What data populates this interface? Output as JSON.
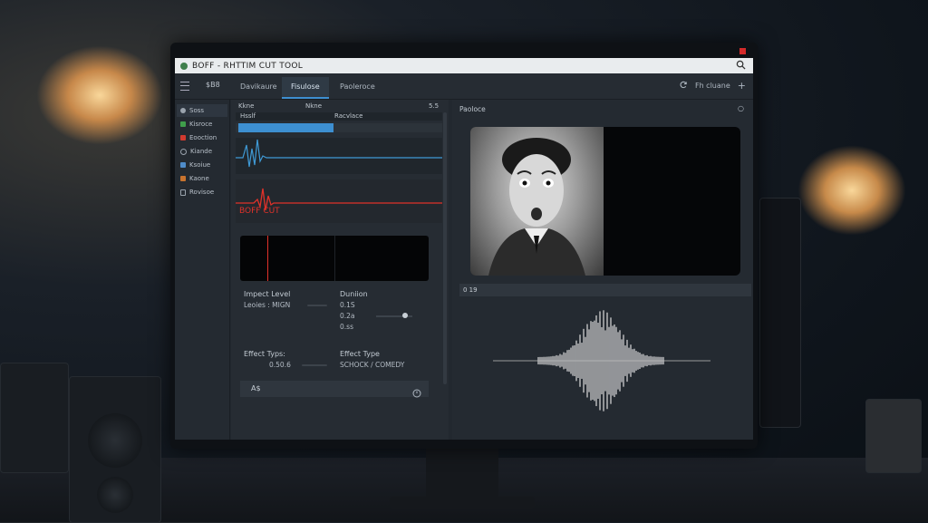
{
  "window": {
    "title": "BOFF - RHTTIM CUT TOOL"
  },
  "topbar": {
    "label": "$B8",
    "tabs": [
      {
        "label": "Davikaure",
        "active": false
      },
      {
        "label": "Fisulose",
        "active": true
      },
      {
        "label": "Paoleroce",
        "active": false
      }
    ],
    "right_label": "Fh cluane"
  },
  "sidebar": {
    "items": [
      {
        "label": "Soss",
        "icon": "gear-icon",
        "color": "#9aa3ad",
        "active": true
      },
      {
        "label": "Kisroce",
        "icon": "scissors-icon",
        "color": "#3f9e4b",
        "active": false
      },
      {
        "label": "Eooction",
        "icon": "record-icon",
        "color": "#d13a2f",
        "active": false
      },
      {
        "label": "Kiande",
        "icon": "circle-icon",
        "color": "#9aa3ad",
        "active": false
      },
      {
        "label": "Ksoiue",
        "icon": "layers-icon",
        "color": "#4f8cc9",
        "active": false
      },
      {
        "label": "Kaone",
        "icon": "film-icon",
        "color": "#c8732e",
        "active": false
      },
      {
        "label": "Rovisoe",
        "icon": "document-icon",
        "color": "#9aa3ad",
        "active": false
      }
    ]
  },
  "timeline": {
    "headers": {
      "col1": "Kkne",
      "col2": "Nkne",
      "col3": "5.5"
    },
    "subheaders": {
      "col1": "Hsslf",
      "col2": "Racvlace"
    },
    "cut_label": "BOFF CUT"
  },
  "settings": {
    "impact_label": "Impect Level",
    "impact_value": "Leoies : MIGN",
    "duration_label": "Duniion",
    "duration_values": [
      "0.1S",
      "0.2a",
      "0.ss"
    ],
    "effect_types_label": "Effect Typs:",
    "effect_types_value": "0.50.6",
    "effect_type_label": "Effect Type",
    "effect_type_value": "SCHOCK / COMEDY",
    "footer_label": "A$",
    "slider_value": 0.8
  },
  "preview": {
    "title": "Paoloce",
    "status": "0 19"
  },
  "colors": {
    "accent": "#3d8fd1",
    "cut_red": "#e0322a",
    "wave_blue": "#3f9ad6"
  }
}
